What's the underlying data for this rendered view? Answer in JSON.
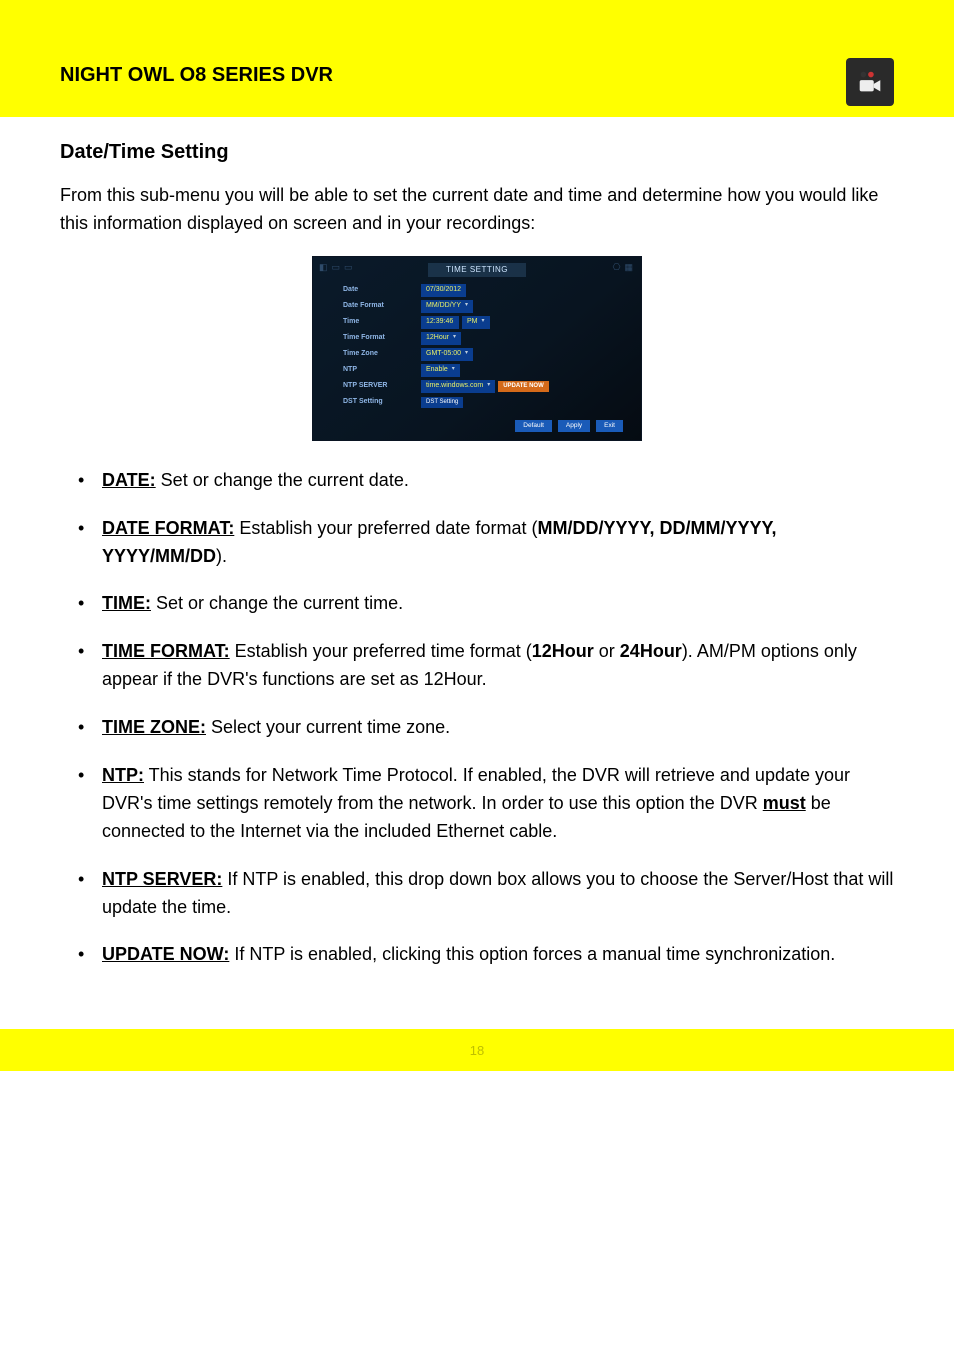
{
  "header": {
    "title": "NIGHT OWL O8 SERIES DVR"
  },
  "section": {
    "heading": "Date/Time Setting",
    "intro": "From this sub-menu you will be able to set the current date and time and determine how you would like this information displayed on screen and in your recordings:"
  },
  "screenshot": {
    "title": "TIME SETTING",
    "rows": {
      "date_label": "Date",
      "date_value": "07/30/2012",
      "datefmt_label": "Date Format",
      "datefmt_value": "MM/DD/YY",
      "time_label": "Time",
      "time_value": "12:39:46",
      "time_ampm": "PM",
      "timefmt_label": "Time Format",
      "timefmt_value": "12Hour",
      "tz_label": "Time Zone",
      "tz_value": "GMT-05:00",
      "ntp_label": "NTP",
      "ntp_value": "Enable",
      "ntpserver_label": "NTP SERVER",
      "ntpserver_value": "time.windows.com",
      "ntpserver_btn": "UPDATE NOW",
      "dst_label": "DST Setting",
      "dst_btn": "DST Setting"
    },
    "footer": {
      "default": "Default",
      "apply": "Apply",
      "exit": "Exit"
    }
  },
  "items": {
    "date": {
      "title": "DATE:",
      "text": " Set or change the current date."
    },
    "date_format": {
      "title": "DATE FORMAT:",
      "text1": " Establish your preferred date format (",
      "hl": "MM/DD/YYYY, DD/MM/YYYY, YYYY/MM/DD",
      "text2": ")."
    },
    "time": {
      "title": "TIME:",
      "text": " Set or change the current time."
    },
    "time_format": {
      "title": "TIME FORMAT:",
      "text1": " Establish your preferred time format (",
      "hl1": "12Hour",
      "mid": " or ",
      "hl2": "24Hour",
      "text2": "). AM/PM options only appear if the DVR's functions are set as 12Hour."
    },
    "time_zone": {
      "title": "TIME ZONE:",
      "text": " Select your current time zone."
    },
    "ntp": {
      "title": "NTP:",
      "text": " This stands for Network Time Protocol. If enabled, the DVR will retrieve and update your DVR's time settings remotely from the network. In order to use this option the DVR ",
      "ub": "must",
      "text2": " be connected to the Internet via the included Ethernet cable."
    },
    "ntp_server": {
      "title": "NTP SERVER:",
      "text": " If NTP is enabled, this drop down box allows you to choose the Server/Host that will update the time."
    },
    "update_now": {
      "title": "UPDATE NOW:",
      "text": " If NTP is enabled, clicking this option forces a manual time synchronization."
    }
  },
  "footer": {
    "page": "18"
  }
}
